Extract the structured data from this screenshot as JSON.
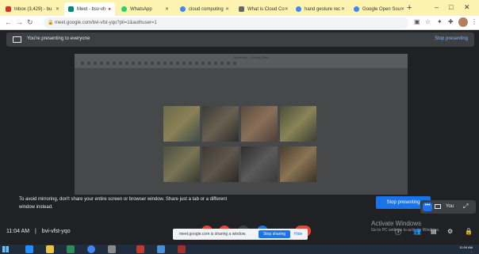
{
  "browser": {
    "tabs": [
      {
        "label": "Inbox (3,429) - bu",
        "favicon_color": "#d93025"
      },
      {
        "label": "Meet - bsv-vh",
        "favicon_color": "#00897b"
      },
      {
        "label": "WhatsApp",
        "favicon_color": "#25d366"
      },
      {
        "label": "cloud computing",
        "favicon_color": "#4285f4"
      },
      {
        "label": "What is Cloud Co",
        "favicon_color": "#666666"
      },
      {
        "label": "hand gesture rec",
        "favicon_color": "#4285f4"
      },
      {
        "label": "Google Open Sou",
        "favicon_color": "#4285f4"
      }
    ],
    "new_tab": "+",
    "window_controls": {
      "minimize": "–",
      "maximize": "□",
      "close": "✕"
    },
    "url": "meet.google.com/bvi-vfst-yqo?pli=1&authuser=1"
  },
  "banner": {
    "text": "You're presenting to everyone",
    "stop_label": "Stop presenting"
  },
  "shared_screen": {
    "window_title": "Document - Google Docs"
  },
  "mirror_warning": "To avoid mirroring, don't share your entire screen or browser window. Share just a tab or a different window instead.",
  "stop_presenting_button": "Stop presenting",
  "self_tile": {
    "more": "•••",
    "label": "You",
    "expand": "⤢"
  },
  "meeting": {
    "time": "11:04 AM",
    "separator": "|",
    "code": "bvi-vfst-yqo"
  },
  "share_toast": {
    "message": "meet.google.com is sharing a window.",
    "stop_label": "Stop sharing",
    "hide_label": "Hide"
  },
  "watermark": {
    "heading": "Activate Windows",
    "sub": "Go to PC settings to activate Windows."
  },
  "taskbar": {
    "clock_time": "11:04 AM",
    "clock_date": "..."
  }
}
